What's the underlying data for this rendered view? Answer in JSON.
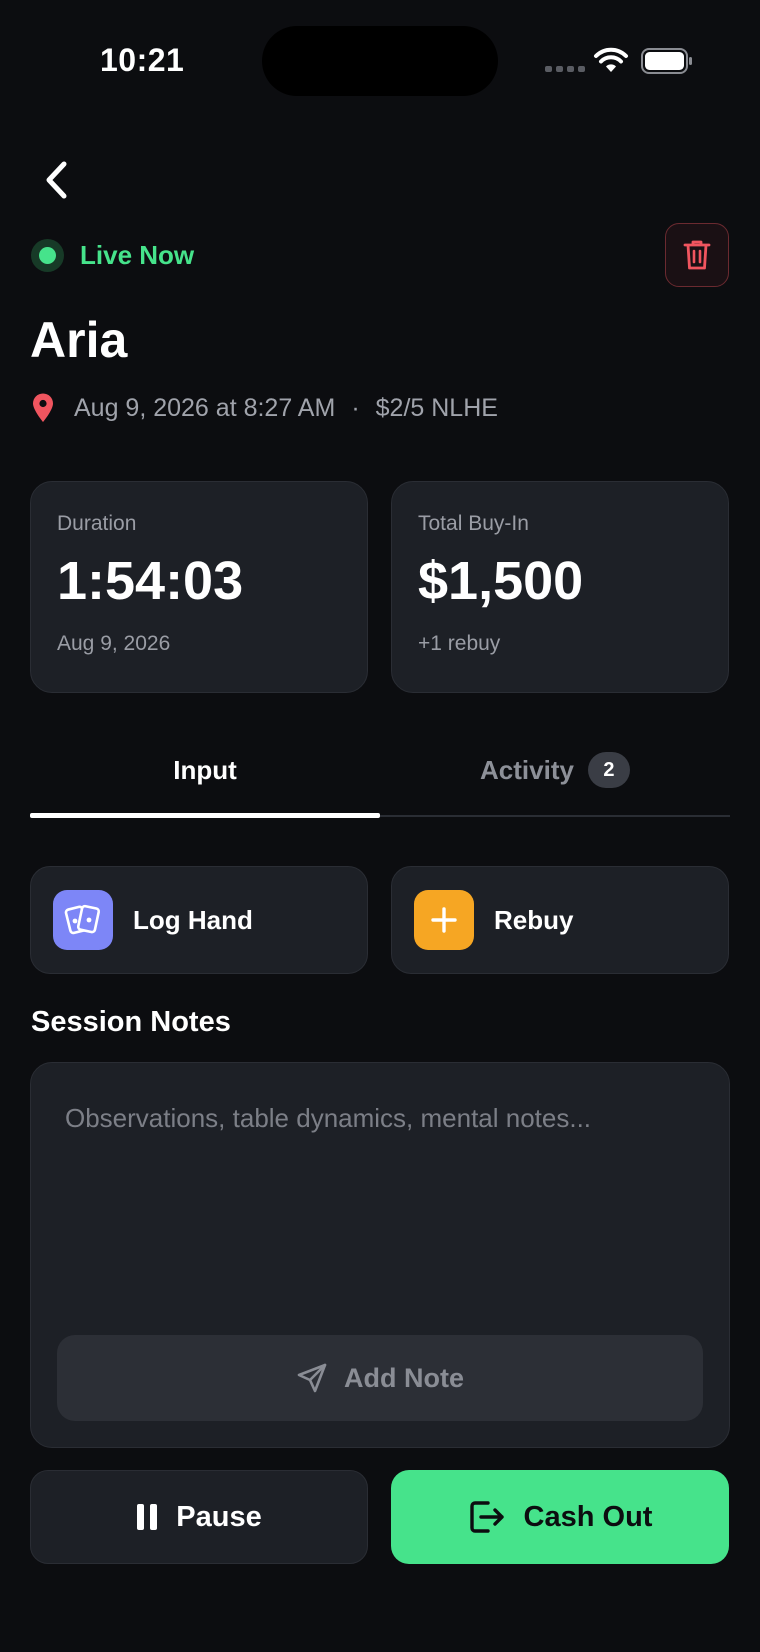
{
  "status_bar": {
    "time": "10:21"
  },
  "header": {
    "live_label": "Live Now",
    "title": "Aria",
    "datetime": "Aug 9, 2026 at 8:27 AM",
    "separator": "·",
    "game": "$2/5 NLHE"
  },
  "stats": {
    "duration": {
      "label": "Duration",
      "value": "1:54:03",
      "sub": "Aug 9, 2026"
    },
    "buy_in": {
      "label": "Total Buy-In",
      "value": "$1,500",
      "sub": "+1 rebuy"
    }
  },
  "tabs": {
    "input": "Input",
    "activity": "Activity",
    "activity_count": "2",
    "selected": "Input"
  },
  "actions": {
    "log_hand": "Log Hand",
    "rebuy": "Rebuy"
  },
  "notes": {
    "title": "Session Notes",
    "placeholder": "Observations, table dynamics, mental notes...",
    "add_label": "Add Note"
  },
  "footer": {
    "pause": "Pause",
    "cash_out": "Cash Out"
  },
  "colors": {
    "accent_green": "#46e38b",
    "danger_red": "#f0555f",
    "log_hand_icon_bg": "#7d86f7",
    "rebuy_icon_bg": "#f6a623"
  },
  "icons": {
    "back": "chevron-left-icon",
    "trash": "trash-icon",
    "location": "map-pin-icon",
    "log_hand": "cards-icon",
    "rebuy": "plus-icon",
    "add_note": "send-icon",
    "pause": "pause-icon",
    "cash_out": "logout-icon"
  }
}
